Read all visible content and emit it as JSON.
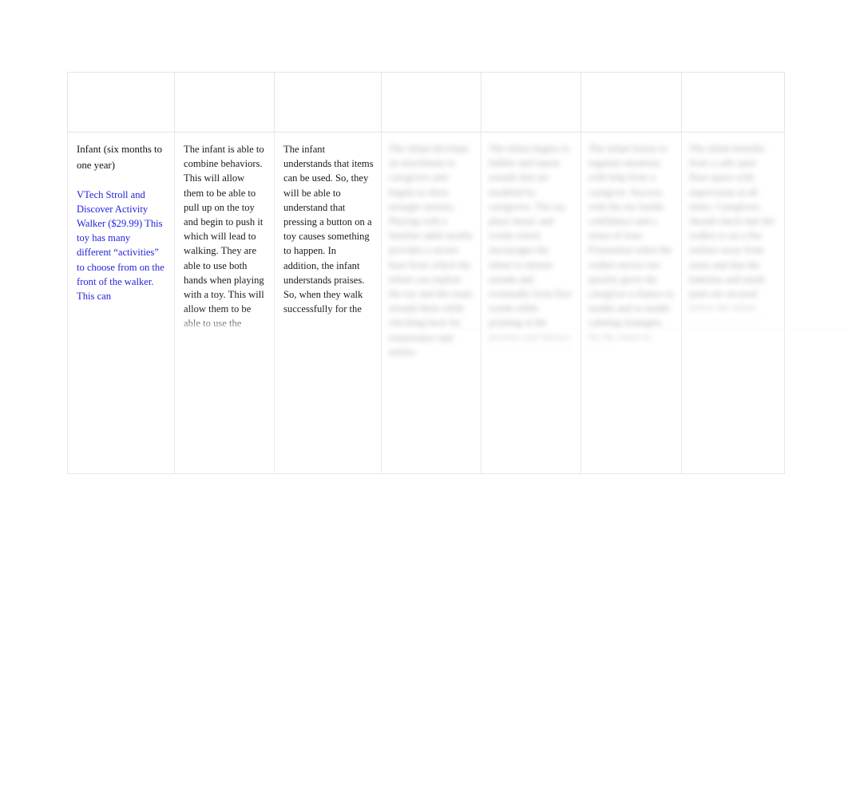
{
  "document": {
    "type": "table",
    "background_color": "#ffffff",
    "border_color": "#e8e8e8",
    "link_color": "#2222dd",
    "text_color": "#1a1a1a",
    "redacted_color": "#9a9a9a"
  },
  "table": {
    "column_count": 7,
    "row_count": 2,
    "header": {
      "cells": [
        "",
        "",
        "",
        "",
        "",
        "",
        ""
      ]
    },
    "rows": [
      {
        "name": "infant-row",
        "cells": [
          {
            "name": "stage-cell",
            "redacted": false,
            "title": "Infant (six months to one year)",
            "link_text": "VTech Stroll and Discover Activity Walker  ($29.99) This toy has many different “activities” to choose from on the front of the walker. This can",
            "body": ""
          },
          {
            "name": "motor-development-cell",
            "redacted": false,
            "title": "",
            "link_text": "",
            "body": "The infant is able to combine behaviors. This will allow them to be able to pull up on the toy and begin to push it which will lead to walking.\nThey are able to use both hands when playing with a toy. This will allow them to be able to use the walker part"
          },
          {
            "name": "cognitive-development-cell",
            "redacted": false,
            "title": "",
            "link_text": "",
            "body": "The infant understands that items can be used. So, they will be able to understand that pressing a button on a toy causes something to happen. In addition, the infant understands praises. So, when they walk successfully for the"
          },
          {
            "name": "redacted-cell-4",
            "redacted": true,
            "fade": "fade-mid",
            "title": "",
            "link_text": "",
            "body": "The infant develops an attachment to caregivers and begins to show stranger anxiety. Playing with a familiar adult nearby provides a secure base from which the infant can explore the toy and the room around them while checking back for reassurance and smiles."
          },
          {
            "name": "redacted-cell-5",
            "redacted": true,
            "fade": "fade-long",
            "title": "",
            "link_text": "",
            "body": "The infant begins to babble and repeat sounds that are modeled by caregivers. The toy plays music and words which encourages the infant to imitate sounds and eventually form first words while pointing at the pictures and buttons on the front panel of the walker."
          },
          {
            "name": "redacted-cell-6",
            "redacted": true,
            "fade": "fade-long",
            "title": "",
            "link_text": "",
            "body": "The infant learns to regulate emotions with help from a caregiver. Success with the toy builds confidence and a sense of trust. Frustration when the walker moves too quickly gives the caregiver a chance to soothe and to model calming strategies for the infant to learn."
          },
          {
            "name": "redacted-cell-7",
            "redacted": true,
            "fade": "fade-xshort",
            "title": "",
            "link_text": "",
            "body": "The infant benefits from a safe open floor space with supervision at all times. Caregivers should check that the walker is on a flat surface away from stairs and that the batteries and small parts are secured before the infant begins to play with the toy."
          }
        ]
      }
    ]
  }
}
